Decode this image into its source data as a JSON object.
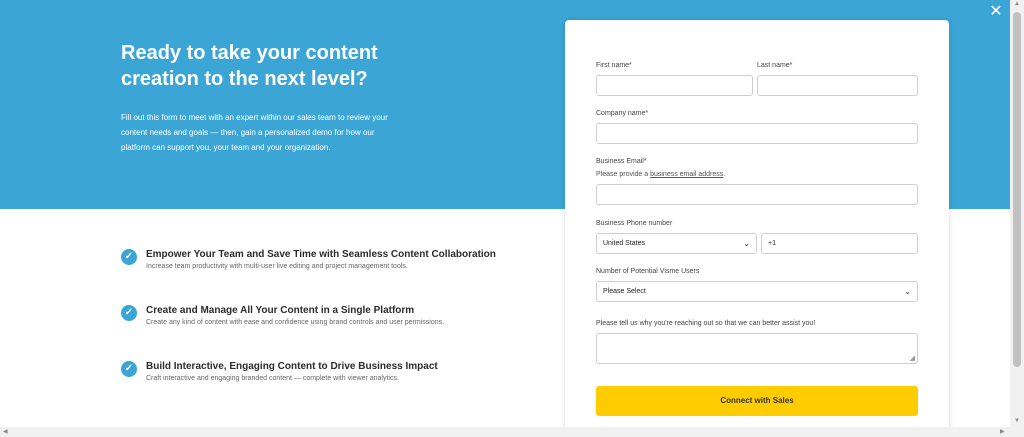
{
  "hero": {
    "title": "Ready to take your content creation to the next level?",
    "description": "Fill out this form to meet with an expert within our sales team to review your content needs and goals — then, gain a personalized demo for how our platform can support you, your team and your organization."
  },
  "features": [
    {
      "title": "Empower Your Team and Save Time with Seamless Content Collaboration",
      "desc": "Increase team productivity with multi-user live editing and project management tools."
    },
    {
      "title": "Create and Manage All Your Content in a Single Platform",
      "desc": "Create any kind of content with ease and confidence using brand controls and user permissions."
    },
    {
      "title": "Build Interactive, Engaging Content to Drive Business Impact",
      "desc": "Craft interactive and engaging branded content — complete with viewer analytics."
    }
  ],
  "form": {
    "first_name_label": "First name*",
    "last_name_label": "Last name*",
    "company_label": "Company name*",
    "email_label": "Business Email*",
    "email_hint_prefix": "Please provide a ",
    "email_hint_link": "business email address",
    "email_hint_suffix": ".",
    "phone_label": "Business Phone number",
    "country_value": "United States",
    "phone_code": "+1",
    "users_label": "Number of Potential Visme Users",
    "users_value": "Please Select",
    "reason_label": "Please tell us why you're reaching out so that we can better assist you!",
    "submit_label": "Connect with Sales"
  },
  "colors": {
    "hero_bg": "#3ba6d6",
    "button_bg": "#ffcc00"
  },
  "icons": {
    "close": "close-icon",
    "check": "check-circle-icon"
  }
}
